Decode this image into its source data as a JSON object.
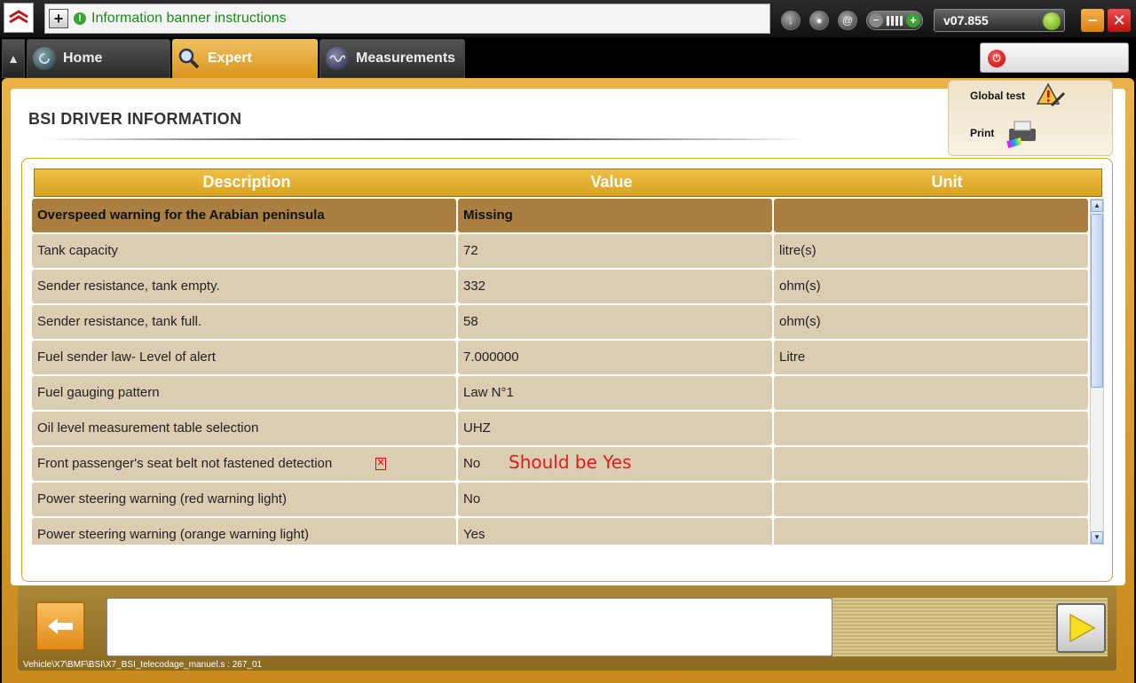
{
  "banner": {
    "text": "Information banner instructions"
  },
  "version": "v07.855",
  "tabs": {
    "home": "Home",
    "expert": "Expert",
    "measurements": "Measurements"
  },
  "page": {
    "title": "BSI  DRIVER INFORMATION"
  },
  "actions": {
    "global_test": "Global test",
    "print": "Print"
  },
  "table": {
    "headers": {
      "description": "Description",
      "value": "Value",
      "unit": "Unit"
    },
    "rows": [
      {
        "description": "Overspeed warning for the Arabian peninsula",
        "value": "Missing",
        "unit": ""
      },
      {
        "description": "Tank capacity",
        "value": "72",
        "unit": "litre(s)"
      },
      {
        "description": "Sender resistance, tank empty.",
        "value": "332",
        "unit": "ohm(s)"
      },
      {
        "description": "Sender resistance, tank full.",
        "value": "58",
        "unit": "ohm(s)"
      },
      {
        "description": "Fuel sender law- Level of alert",
        "value": "7.000000",
        "unit": "Litre"
      },
      {
        "description": "Fuel gauging pattern",
        "value": "Law N°1",
        "unit": ""
      },
      {
        "description": "Oil level measurement table selection",
        "value": "UHZ",
        "unit": ""
      },
      {
        "description": "Front passenger's seat belt not fastened detection",
        "value": "No",
        "unit": ""
      },
      {
        "description": "Power steering warning (red warning light)",
        "value": "No",
        "unit": ""
      },
      {
        "description": "Power steering warning (orange warning light)",
        "value": "Yes",
        "unit": ""
      }
    ]
  },
  "annotation": {
    "text": "Should be Yes"
  },
  "status_path": "Vehicle\\X7\\BMF\\BSI\\X7_BSI_telecodage_manuel.s : 267_01",
  "colors": {
    "accent": "#e0a030",
    "highlight_row": "#aa8040",
    "row": "#dccdb2",
    "annotation": "#e01a1a"
  }
}
